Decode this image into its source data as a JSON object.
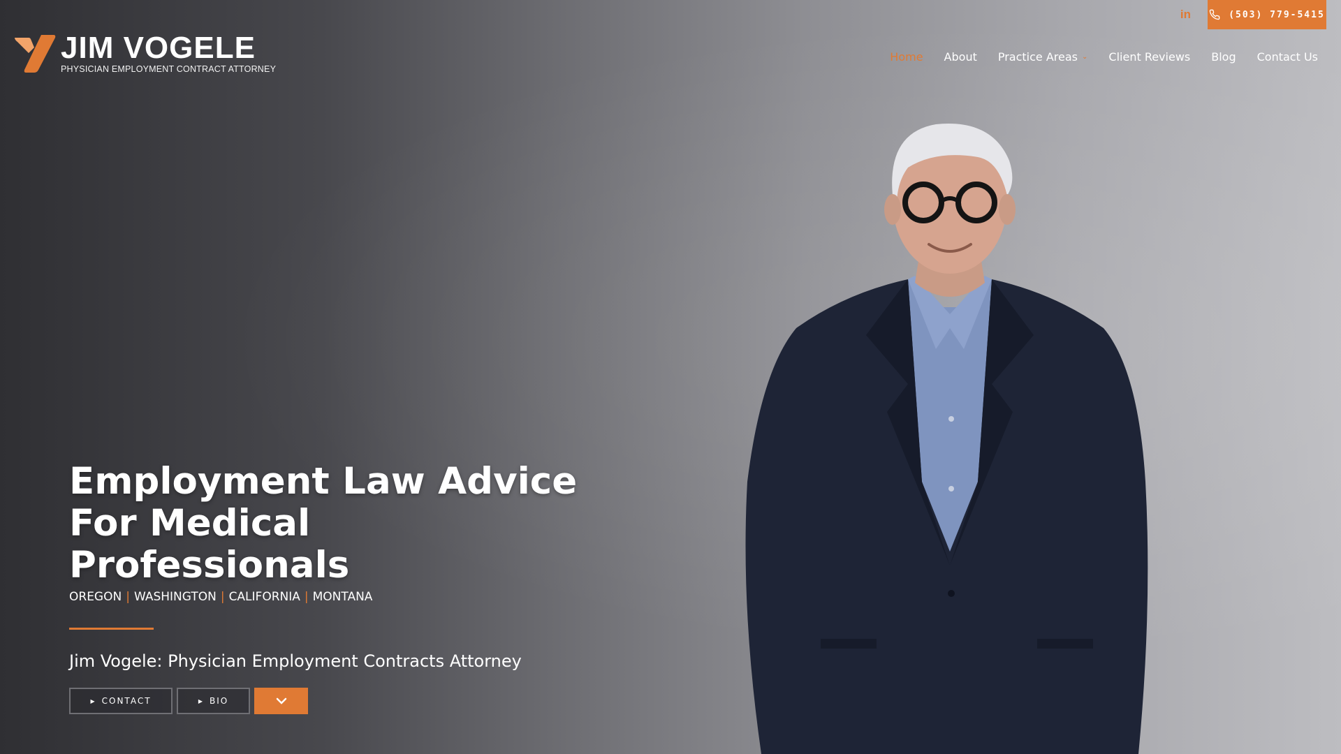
{
  "brand": {
    "name": "JIM VOGELE",
    "subtitle": "PHYSICIAN EMPLOYMENT CONTRACT ATTORNEY",
    "accent_color": "#e07a34"
  },
  "utility": {
    "linkedin_label": "in",
    "phone": "(503) 779-5415"
  },
  "nav": {
    "items": [
      {
        "label": "Home",
        "active": true
      },
      {
        "label": "About",
        "active": false
      },
      {
        "label": "Practice Areas",
        "active": false,
        "dropdown": true
      },
      {
        "label": "Client Reviews",
        "active": false
      },
      {
        "label": "Blog",
        "active": false
      },
      {
        "label": "Contact Us",
        "active": false
      }
    ]
  },
  "hero": {
    "title_line1": "Employment Law Advice",
    "title_line2": "For Medical Professionals",
    "states": [
      "OREGON",
      "WASHINGTON",
      "CALIFORNIA",
      "MONTANA"
    ],
    "state_separator": "|",
    "tagline": "Jim Vogele: Physician Employment Contracts Attorney",
    "buttons": {
      "contact": "CONTACT",
      "bio": "BIO"
    }
  },
  "icons": {
    "phone": "phone-icon",
    "linkedin": "linkedin-icon",
    "play": "caret-right-icon",
    "down": "chevron-down-icon"
  }
}
